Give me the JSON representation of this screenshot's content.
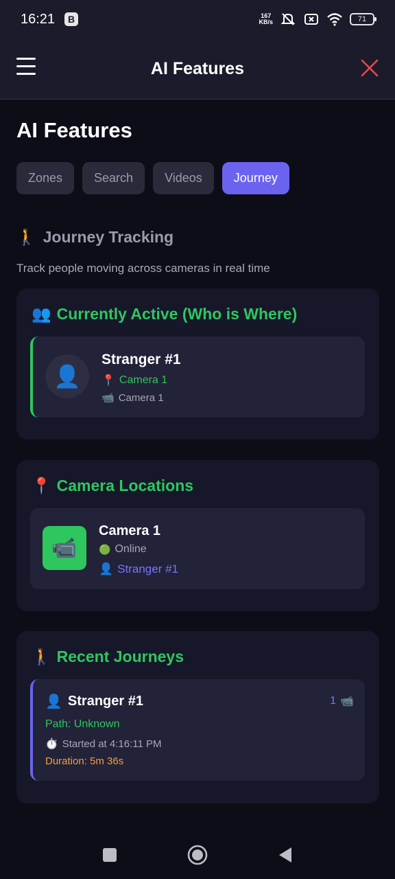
{
  "status": {
    "time": "16:21",
    "b_badge": "B",
    "net_speed_value": "167",
    "net_speed_unit": "KB/s",
    "battery": "71"
  },
  "header": {
    "title": "AI Features"
  },
  "page": {
    "title": "AI Features",
    "tabs": [
      {
        "label": "Zones",
        "active": false
      },
      {
        "label": "Search",
        "active": false
      },
      {
        "label": "Videos",
        "active": false
      },
      {
        "label": "Journey",
        "active": true
      }
    ]
  },
  "journey_section": {
    "icon": "🚶",
    "title": "Journey Tracking",
    "subtitle": "Track people moving across cameras in real time"
  },
  "active_card": {
    "icon": "👥",
    "title": "Currently Active (Who is Where)",
    "person": {
      "avatar_icon": "👤",
      "name": "Stranger #1",
      "location_icon": "📍",
      "location": "Camera 1",
      "camera_icon": "📹",
      "camera": "Camera 1"
    }
  },
  "locations_card": {
    "icon": "📍",
    "title": "Camera Locations",
    "camera": {
      "icon": "📹",
      "name": "Camera 1",
      "status_icon": "🟢",
      "status": "Online",
      "person_icon": "👤",
      "person": "Stranger #1"
    }
  },
  "journeys_card": {
    "icon": "🚶",
    "title": "Recent Journeys",
    "journey": {
      "person_icon": "👤",
      "name": "Stranger #1",
      "camera_count": "1",
      "camera_icon": "📹",
      "path": "Path: Unknown",
      "timer_icon": "⏱️",
      "started": "Started at 4:16:11 PM",
      "duration": "Duration: 5m 36s"
    }
  },
  "colors": {
    "accent": "#6b63f0",
    "green": "#2ec75e",
    "orange": "#f59e3b",
    "close": "#e5484d"
  }
}
